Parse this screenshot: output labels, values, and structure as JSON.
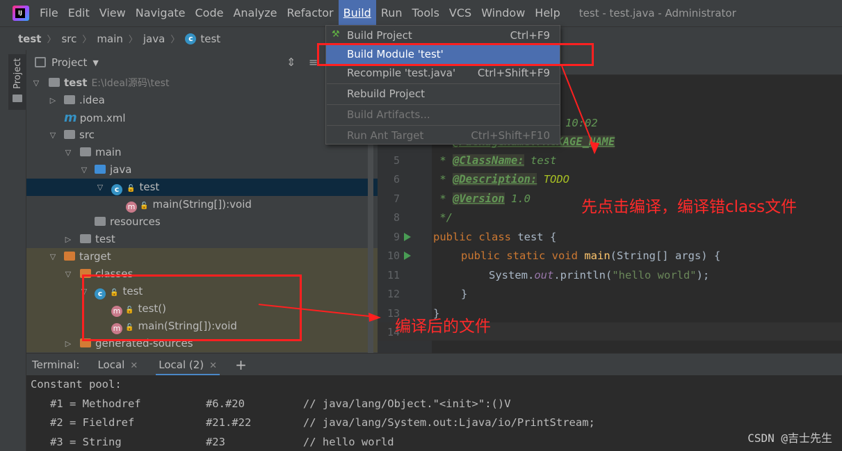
{
  "menubar": {
    "logo": "IJ",
    "items": [
      "File",
      "Edit",
      "View",
      "Navigate",
      "Code",
      "Analyze",
      "Refactor",
      "Build",
      "Run",
      "Tools",
      "VCS",
      "Window",
      "Help"
    ],
    "active_item": "Build",
    "window_title": "test - test.java - Administrator"
  },
  "breadcrumb": [
    "test",
    "src",
    "main",
    "java",
    "test"
  ],
  "tool_stripe": {
    "label": "Project"
  },
  "project_panel": {
    "title": "Project",
    "tree": [
      {
        "label": "test",
        "hint": "E:\\Ideal源码\\test",
        "icon": "module-folder-icon"
      },
      {
        "label": ".idea",
        "icon": "folder-icon"
      },
      {
        "label": "pom.xml",
        "icon": "maven-icon"
      },
      {
        "label": "src",
        "icon": "folder-icon"
      },
      {
        "label": "main",
        "icon": "folder-icon"
      },
      {
        "label": "java",
        "icon": "source-folder-icon"
      },
      {
        "label": "test",
        "icon": "class-icon"
      },
      {
        "label": "main(String[]):void",
        "icon": "method-icon"
      },
      {
        "label": "resources",
        "icon": "resources-folder-icon"
      },
      {
        "label": "test",
        "icon": "folder-icon"
      },
      {
        "label": "target",
        "icon": "excluded-folder-icon"
      },
      {
        "label": "classes",
        "icon": "excluded-folder-icon"
      },
      {
        "label": "test",
        "icon": "class-icon"
      },
      {
        "label": "test()",
        "icon": "method-icon"
      },
      {
        "label": "main(String[]):void",
        "icon": "method-icon"
      },
      {
        "label": "generated-sources",
        "icon": "excluded-folder-icon"
      }
    ]
  },
  "build_menu": {
    "items": [
      {
        "label": "Build Project",
        "shortcut": "Ctrl+F9"
      },
      {
        "label": "Build Module 'test'",
        "shortcut": ""
      },
      {
        "label": "Recompile 'test.java'",
        "shortcut": "Ctrl+Shift+F9"
      },
      {
        "label": "Rebuild Project",
        "shortcut": ""
      },
      {
        "label": "Build Artifacts...",
        "shortcut": ""
      },
      {
        "label": "Run Ant Target",
        "shortcut": "Ctrl+Shift+F10"
      }
    ]
  },
  "editor": {
    "line_numbers": [
      "5",
      "6",
      "7",
      "8",
      "9",
      "10",
      "11",
      "12",
      "13",
      "14"
    ],
    "fragments": {
      "date_tail": "10:02",
      "pkg_tag": "@PackageName:",
      "pkg_val": "PACKAGE_NAME",
      "cls_tag": "@ClassName:",
      "cls_val": "test",
      "desc_tag": "@Description:",
      "desc_val": "TODO",
      "ver_tag": "@Version",
      "ver_val": "1.0",
      "doc_star": " *",
      "doc_end": " */",
      "kw_public_class": "public class",
      "class_name": " test {",
      "kw_public_static_void": "public static void",
      "fn_main": "main",
      "main_params": "(String[] args) {",
      "sys_prefix": "System.",
      "out_field": "out",
      "println": ".println(",
      "hello_str": "\"hello world\"",
      "close_stmt": ");",
      "brace_inner": "}",
      "brace_outer": "}"
    }
  },
  "annotations": {
    "compile_hint": "先点击编译，编译错class文件",
    "compiled_files": "编译后的文件"
  },
  "terminal": {
    "label": "Terminal:",
    "tabs": [
      "Local",
      "Local (2)"
    ],
    "add": "+",
    "lines": [
      "Constant pool:",
      "   #1 = Methodref          #6.#20         // java/lang/Object.\"<init>\":()V",
      "   #2 = Fieldref           #21.#22        // java/lang/System.out:Ljava/io/PrintStream;",
      "   #3 = String             #23            // hello world"
    ]
  },
  "watermark": "CSDN @吉士先生",
  "colors": {
    "accent": "#4b6eaf",
    "annotation": "#ff2020"
  }
}
